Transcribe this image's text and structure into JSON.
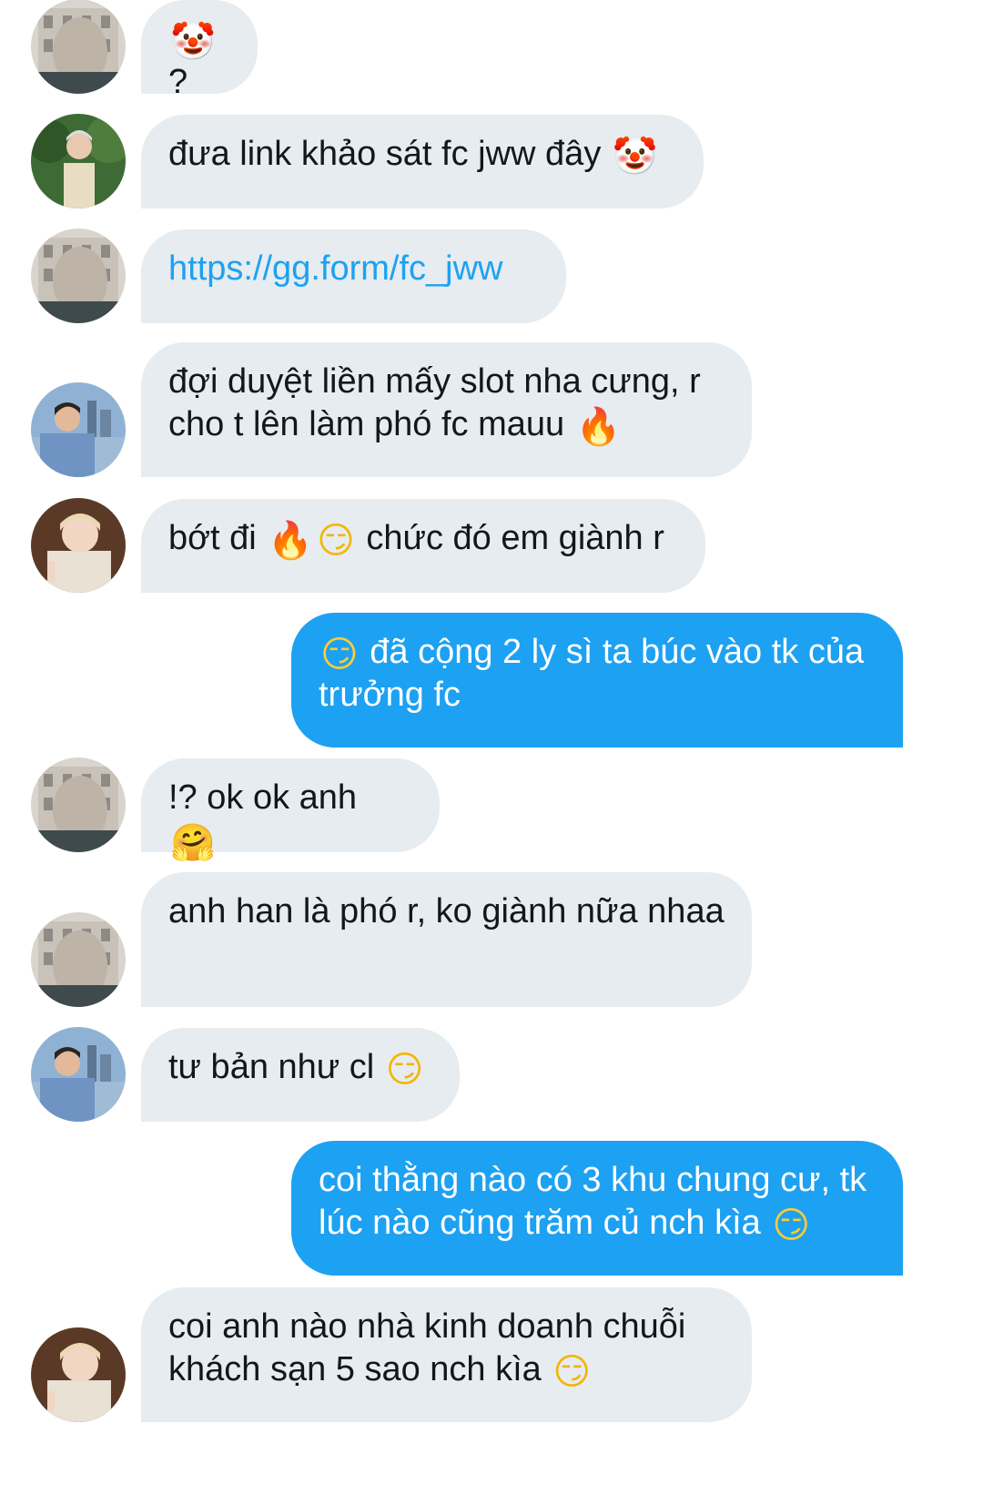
{
  "messages": [
    {
      "side": "in",
      "avatar": "avatar-building",
      "parts": [
        {
          "e": "clown-face-emoji",
          "g": "🤡",
          "c": "clown"
        },
        {
          "t": "?"
        }
      ]
    },
    {
      "side": "in",
      "avatar": "avatar-man-forest",
      "parts": [
        {
          "t": "đưa link khảo sát fc jww đây "
        },
        {
          "e": "clown-face-emoji",
          "g": "🤡",
          "c": "clown"
        }
      ]
    },
    {
      "side": "in",
      "avatar": "avatar-building",
      "parts": [
        {
          "t": "https://gg.form/fc_jww",
          "link": true
        }
      ]
    },
    {
      "side": "in",
      "avatar": "avatar-man-city",
      "parts": [
        {
          "t": "đợi duyệt liền mấy slot nha cưng, r cho t lên làm phó fc mauu "
        },
        {
          "e": "fire-emoji",
          "g": "🔥",
          "c": "fire"
        }
      ]
    },
    {
      "side": "in",
      "avatar": "avatar-blond-peace",
      "parts": [
        {
          "t": "bớt đi "
        },
        {
          "e": "fire-emoji",
          "g": "🔥",
          "c": "fire"
        },
        {
          "e": "smirk-emoji",
          "g": "😏",
          "c": "yellow"
        },
        {
          "t": " chức đó em giành r"
        }
      ]
    },
    {
      "side": "out",
      "parts": [
        {
          "e": "smirk-emoji",
          "g": "😏",
          "c": "yellow"
        },
        {
          "t": " đã cộng 2 ly sì ta búc vào tk của trưởng fc"
        }
      ]
    },
    {
      "side": "in",
      "avatar": "avatar-building",
      "parts": [
        {
          "t": "!? ok ok anh "
        },
        {
          "e": "hugging-face-emoji",
          "g": "🤗",
          "c": "hug"
        }
      ]
    },
    {
      "side": "in",
      "avatar": "avatar-building",
      "parts": [
        {
          "t": "anh han là phó r, ko giành nữa nhaa"
        }
      ]
    },
    {
      "side": "in",
      "avatar": "avatar-man-city",
      "parts": [
        {
          "t": "tư bản như cl "
        },
        {
          "e": "smirk-emoji",
          "g": "😏",
          "c": "yellow"
        }
      ]
    },
    {
      "side": "out",
      "parts": [
        {
          "t": "coi thằng nào có 3 khu chung cư, tk lúc nào cũng trăm củ nch kìa "
        },
        {
          "e": "smirk-emoji",
          "g": "😏",
          "c": "yellow"
        }
      ]
    },
    {
      "side": "in",
      "avatar": "avatar-blond-peace",
      "parts": [
        {
          "t": "coi anh nào nhà kinh doanh chuỗi khách sạn 5 sao nch kìa "
        },
        {
          "e": "smirk-emoji",
          "g": "😏",
          "c": "yellow"
        }
      ]
    }
  ],
  "colors": {
    "incoming_bubble": "#e6ecf0",
    "outgoing_bubble": "#1da1f2",
    "link": "#1da1f2",
    "text": "#14171a"
  }
}
